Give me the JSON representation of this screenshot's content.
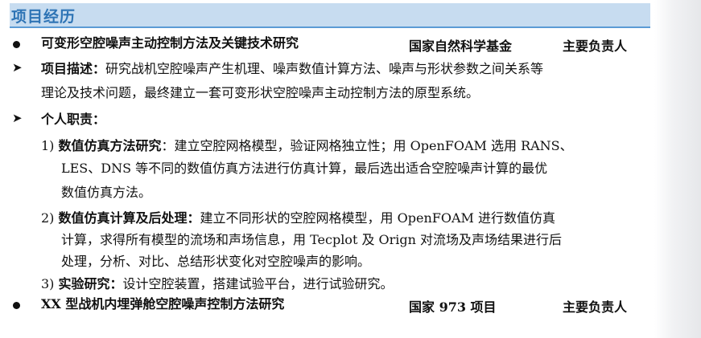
{
  "section": {
    "title": "项目经历"
  },
  "projects": [
    {
      "title": "可变形空腔噪声主动控制方法及关键技术研究",
      "funding": "国家自然科学基金",
      "role": "主要负责人"
    },
    {
      "title": "XX 型战机内埋弹舱空腔噪声控制方法研究",
      "funding": "国家 973 项目",
      "role": "主要负责人"
    }
  ],
  "description": {
    "label": "项目描述：",
    "line1": "研究战机空腔噪声产生机理、噪声数值计算方法、噪声与形状参数之间关系等",
    "line2": "理论及技术问题，最终建立一套可变形状空腔噪声主动控制方法的原型系统。"
  },
  "duties": {
    "label": "个人职责：",
    "items": [
      {
        "num": "1)",
        "heading": "数值仿真方法研究",
        "line1": "：建立空腔网格模型，验证网格独立性；用 OpenFOAM 选用 RANS、",
        "line2": "LES、DNS 等不同的数值仿真方法进行仿真计算，最后选出适合空腔噪声计算的最优",
        "line3": "数值仿真方法。"
      },
      {
        "num": "2)",
        "heading": "数值仿真计算及后处理：",
        "line1": "建立不同形状的空腔网格模型，用 OpenFOAM 进行数值仿真",
        "line2": "计算，求得所有模型的流场和声场信息，用 Tecplot 及 Orign 对流场及声场结果进行后",
        "line3": "处理，分析、对比、总结形状变化对空腔噪声的影响。"
      },
      {
        "num": "3)",
        "heading": "实验研究：",
        "line1": "设计空腔装置，搭建试验平台，进行试验研究。"
      }
    ]
  }
}
